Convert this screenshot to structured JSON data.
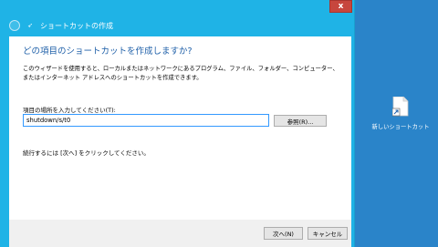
{
  "window": {
    "close_label": "x",
    "title": "ショートカットの作成"
  },
  "wizard": {
    "heading": "どの項目のショートカットを作成しますか?",
    "description": "このウィザードを使用すると、ローカルまたはネットワークにあるプログラム、ファイル、フォルダー、コンピューター、またはインターネット アドレスへのショートカットを作成できます。",
    "location_label": "項目の場所を入力してください(T):",
    "location_value": "shutdown/s/t0",
    "browse_label": "参照(R)...",
    "continue_hint": "続行するには [次へ] をクリックしてください。"
  },
  "footer": {
    "next_label": "次へ(N)",
    "cancel_label": "キャンセル"
  },
  "desktop": {
    "icon_label": "新しいショートカット"
  },
  "colors": {
    "desktop_bg": "#2a84c9",
    "wizard_frame": "#1fb3e6",
    "heading_blue": "#1e5fa8",
    "close_red": "#c7463d"
  }
}
